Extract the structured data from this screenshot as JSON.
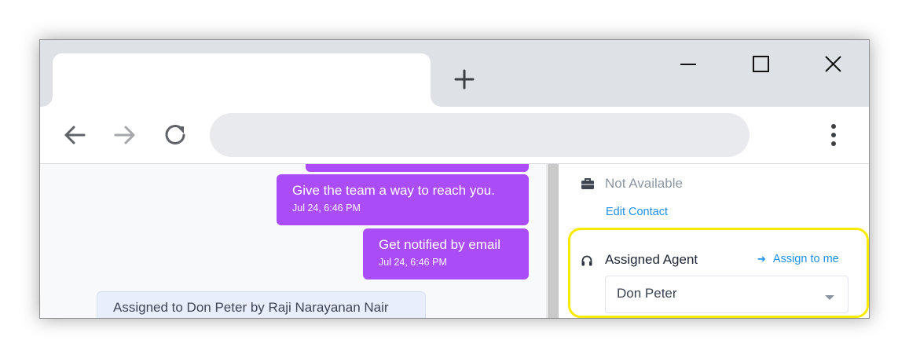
{
  "browser": {
    "tab_title": "",
    "address_bar": "",
    "icons": {
      "new_tab": "plus-icon",
      "minimize": "minimize-icon",
      "maximize": "maximize-icon",
      "close": "close-icon",
      "back": "back-arrow-icon",
      "forward": "forward-arrow-icon",
      "reload": "reload-icon",
      "menu": "kebab-menu-icon"
    }
  },
  "chat": {
    "messages": [
      {
        "text": "Give the team a way to reach you.",
        "time": "Jul 24, 6:46 PM"
      },
      {
        "text": "Get notified by email",
        "time": "Jul 24, 6:46 PM"
      }
    ],
    "activity": "Assigned to Don Peter by Raji Narayanan Nair",
    "outgoing_color": "#ab4cf9"
  },
  "contact_panel": {
    "company_icon": "briefcase-icon",
    "company": "Not Available",
    "edit_contact": "Edit Contact"
  },
  "assigned_agent": {
    "icon": "headset-icon",
    "title": "Assigned Agent",
    "assign_to_me": "Assign to me",
    "selected": "Don Peter",
    "highlight_color": "#f7ec00"
  }
}
